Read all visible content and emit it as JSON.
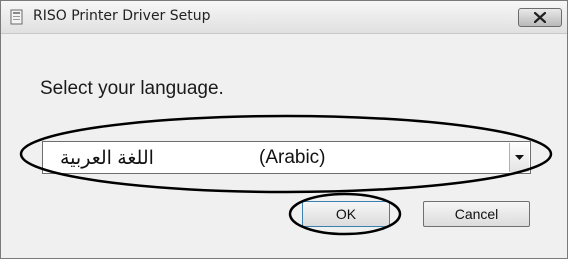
{
  "window": {
    "title": "RISO Printer Driver Setup",
    "app_icon": "setup-icon",
    "close_icon": "close-icon"
  },
  "main": {
    "prompt": "Select your language.",
    "language_select": {
      "native_name": "اللغة العربية",
      "english_name": "(Arabic)",
      "arrow_icon": "chevron-down-icon"
    }
  },
  "buttons": {
    "ok_label": "OK",
    "cancel_label": "Cancel"
  },
  "colors": {
    "window_bg": "#f0f0f0",
    "annotation_stroke": "#000000"
  }
}
